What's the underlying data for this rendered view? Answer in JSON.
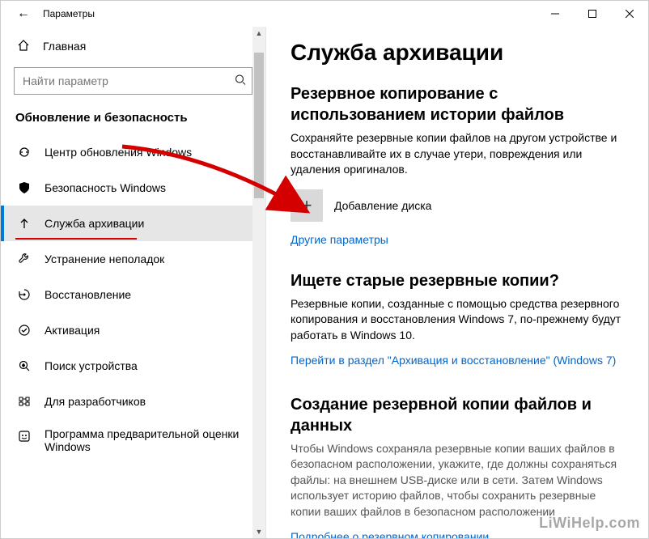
{
  "window": {
    "title": "Параметры",
    "back_label": "←"
  },
  "sidebar": {
    "home": "Главная",
    "search_placeholder": "Найти параметр",
    "group": "Обновление и безопасность",
    "items": [
      {
        "label": "Центр обновления Windows"
      },
      {
        "label": "Безопасность Windows"
      },
      {
        "label": "Служба архивации",
        "selected": true
      },
      {
        "label": "Устранение неполадок"
      },
      {
        "label": "Восстановление"
      },
      {
        "label": "Активация"
      },
      {
        "label": "Поиск устройства"
      },
      {
        "label": "Для разработчиков"
      },
      {
        "label": "Программа предварительной оценки Windows"
      }
    ]
  },
  "page": {
    "title": "Служба архивации",
    "section1": {
      "title": "Резервное копирование с использованием истории файлов",
      "body": "Сохраняйте резервные копии файлов на другом устройстве и восстанавливайте их в случае утери, повреждения или удаления оригиналов.",
      "add_drive": "Добавление диска",
      "more_options": "Другие параметры"
    },
    "section2": {
      "title": "Ищете старые резервные копии?",
      "body": "Резервные копии, созданные с помощью средства резервного копирования и восстановления Windows 7, по-прежнему будут работать в Windows 10.",
      "link": "Перейти в раздел \"Архивация и восстановление\" (Windows 7)"
    },
    "section3": {
      "title": "Создание резервной копии файлов и данных",
      "body": "Чтобы Windows сохраняла резервные копии ваших файлов в безопасном расположении, укажите, где должны сохраняться файлы: на внешнем USB-диске или в сети. Затем Windows использует историю файлов, чтобы сохранить резервные копии ваших файлов в безопасном расположении",
      "link": "Подробнее о резервном копировании"
    }
  },
  "watermark": "LiWiHelp.com"
}
